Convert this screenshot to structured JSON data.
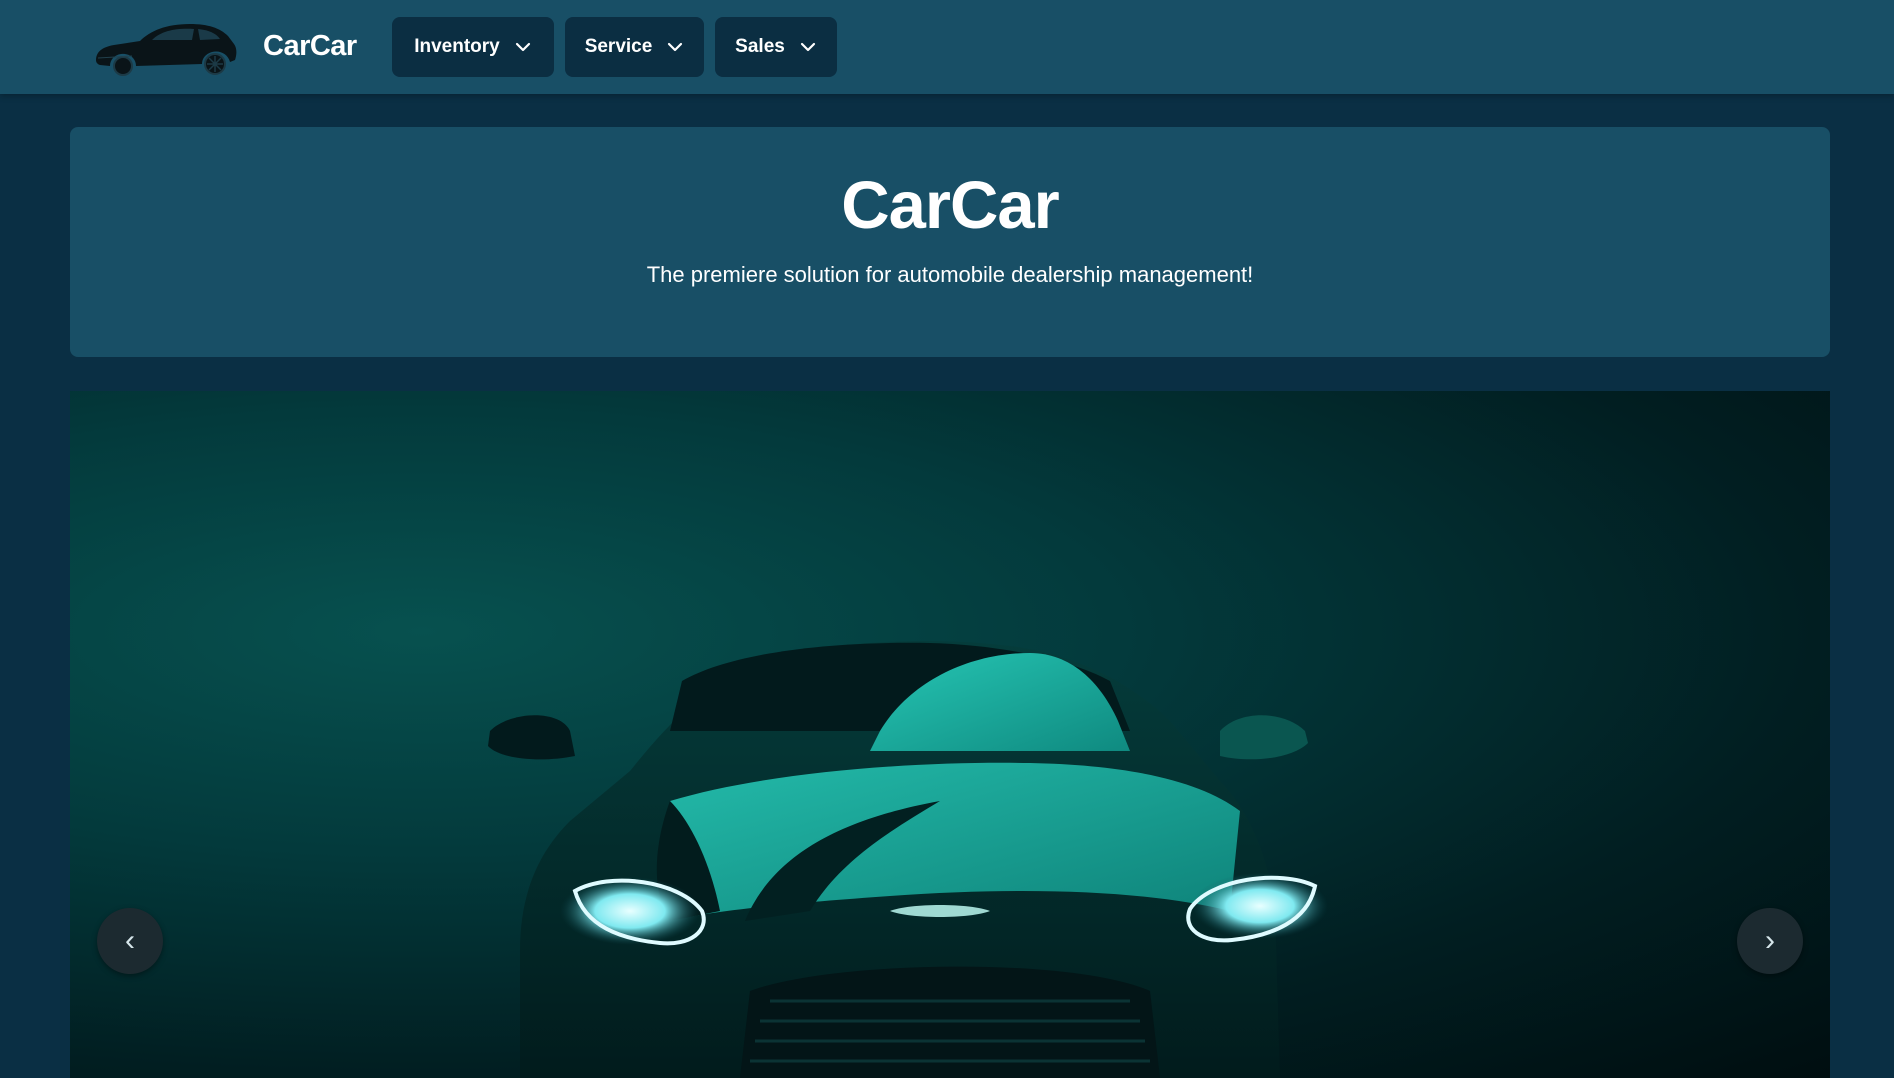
{
  "navbar": {
    "brand_name": "CarCar",
    "brand_icon": "car-silhouette-icon",
    "menus": [
      {
        "label": "Inventory",
        "icon": "chevron-down-icon"
      },
      {
        "label": "Service",
        "icon": "chevron-down-icon"
      },
      {
        "label": "Sales",
        "icon": "chevron-down-icon"
      }
    ]
  },
  "hero": {
    "title": "CarCar",
    "subtitle": "The premiere solution for automobile dealership management!"
  },
  "carousel": {
    "prev_label": "‹",
    "next_label": "›",
    "slide_icon": "sports-car-front-photo"
  },
  "colors": {
    "page_background": "#0a2f44",
    "navbar_background": "#184f66",
    "menu_button_background": "#0b2e42",
    "hero_background": "#184f66",
    "car_accent": "#1fb7a8"
  }
}
